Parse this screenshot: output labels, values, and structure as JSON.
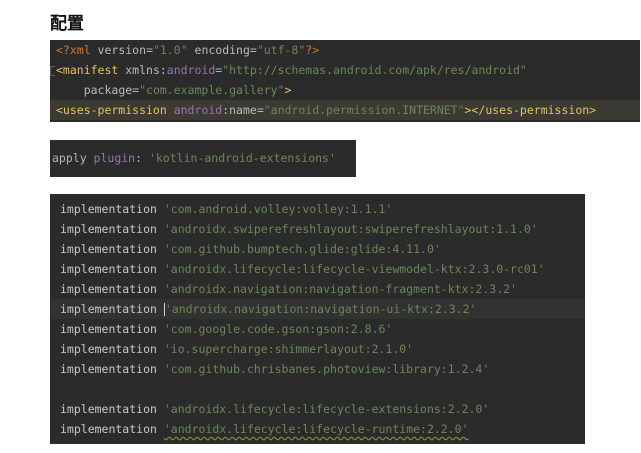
{
  "title": "配置",
  "xml": {
    "line1": {
      "open": "<?xml ",
      "version_attr": "version",
      "eq1": "=",
      "version_val": "\"1.0\"",
      "sp": " ",
      "encoding_attr": "encoding",
      "eq2": "=",
      "encoding_val": "\"utf-8\"",
      "close": "?>"
    },
    "line2": {
      "tag": "<manifest ",
      "attr": "xmlns:",
      "ns": "android",
      "eq": "=",
      "val": "\"http://schemas.android.com/apk/res/android\""
    },
    "line3": {
      "indent": "    ",
      "attr": "package",
      "eq": "=",
      "val": "\"com.example.gallery\"",
      "close": ">"
    },
    "line4": {
      "tag": "<uses-permission ",
      "ns": "android",
      "colon": ":",
      "attr": "name",
      "eq": "=",
      "val": "\"android.permission.INTERNET\"",
      "close": "></uses-permission>"
    }
  },
  "gradle_plugin": {
    "apply": "apply ",
    "plugin": "plugin",
    "colon": ": ",
    "value": "'kotlin-android-extensions'"
  },
  "deps": {
    "keyword": "implementation ",
    "items": [
      "'com.android.volley:volley:1.1.1'",
      "'androidx.swiperefreshlayout:swiperefreshlayout:1.1.0'",
      "'com.github.bumptech.glide:glide:4.11.0'",
      "'androidx.lifecycle:lifecycle-viewmodel-ktx:2.3.0-rc01'",
      "'androidx.navigation:navigation-fragment-ktx:2.3.2'",
      "'androidx.navigation:navigation-ui-ktx:2.3.2'",
      "'com.google.code.gson:gson:2.8.6'",
      "'io.supercharge:shimmerlayout:2.1.0'",
      "'com.github.chrisbanes.photoview:library:1.2.4'",
      "'androidx.lifecycle:lifecycle-extensions:2.2.0'",
      "'androidx.lifecycle:lifecycle-runtime:2.2.0'"
    ]
  }
}
